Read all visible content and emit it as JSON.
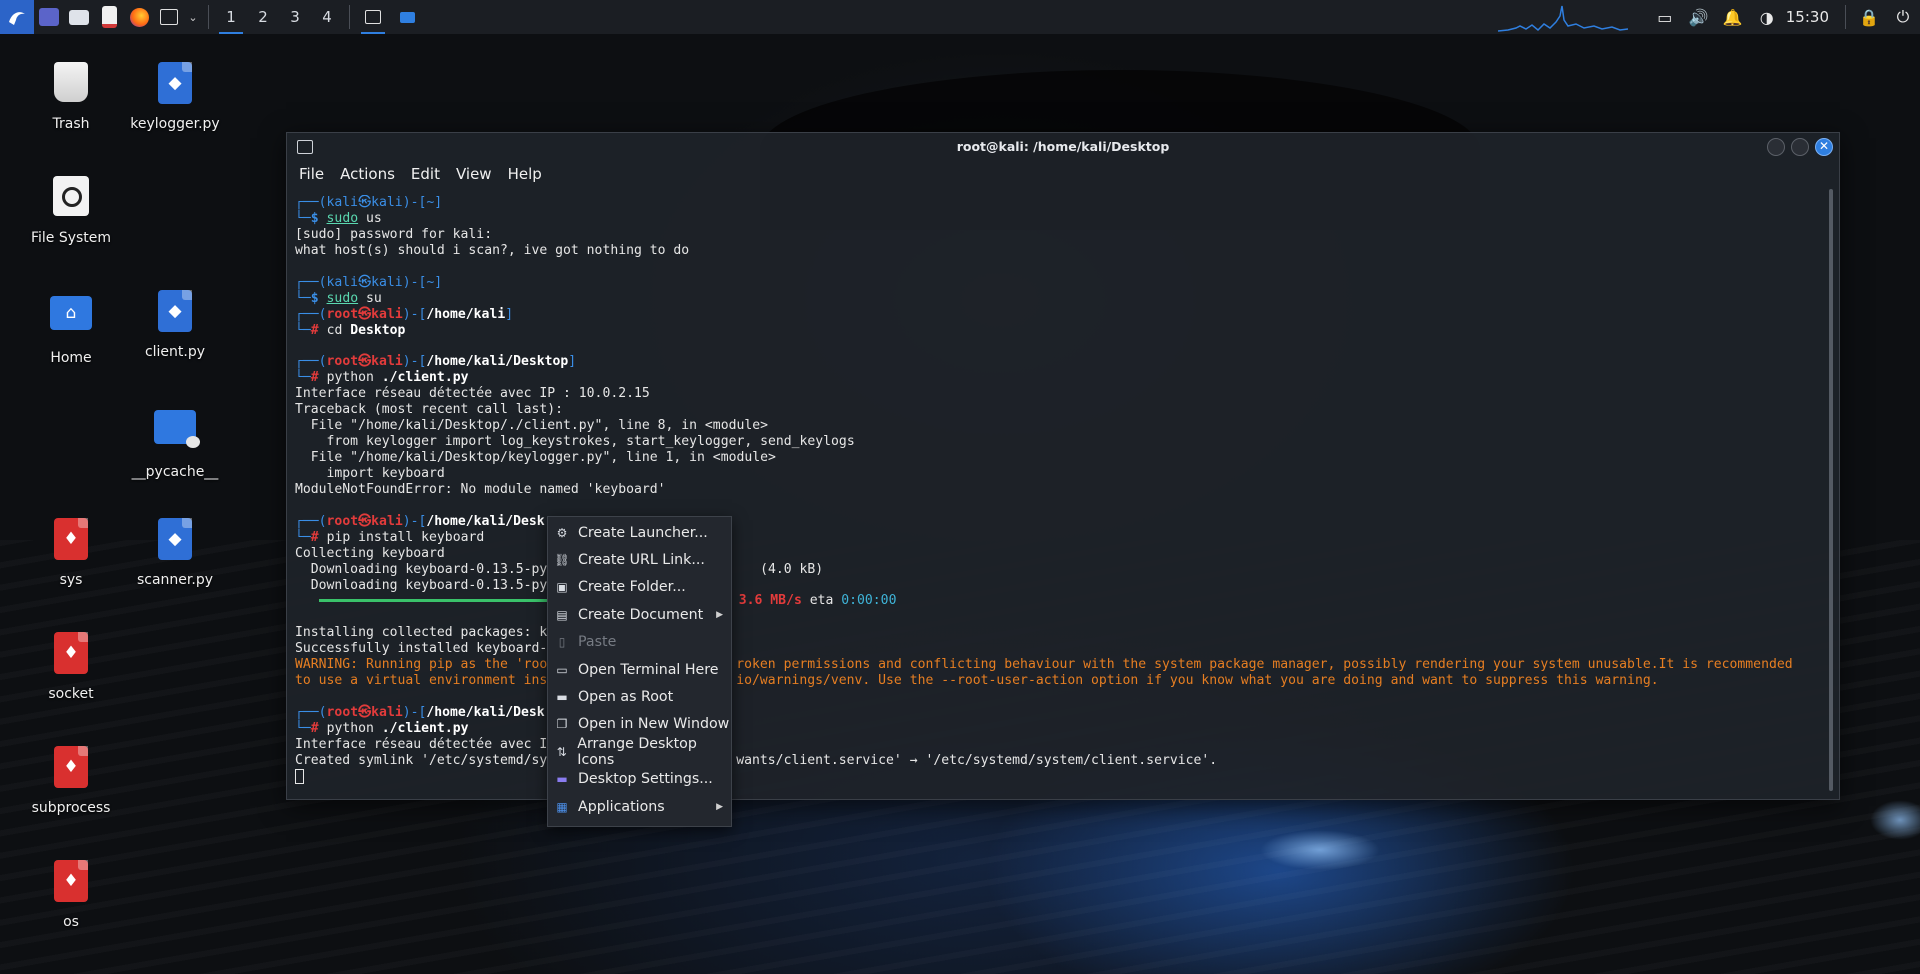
{
  "panel": {
    "workspaces": [
      "1",
      "2",
      "3",
      "4"
    ],
    "clock": "15:30"
  },
  "desktop_icons": [
    {
      "label": "Trash"
    },
    {
      "label": "keylogger.py"
    },
    {
      "label": "File System"
    },
    {
      "label": "Home"
    },
    {
      "label": "client.py"
    },
    {
      "label": "__pycache__"
    },
    {
      "label": "sys"
    },
    {
      "label": "scanner.py"
    },
    {
      "label": "socket"
    },
    {
      "label": "subprocess"
    },
    {
      "label": "os"
    }
  ],
  "terminal": {
    "title": "root@kali: /home/kali/Desktop",
    "menu": [
      "File",
      "Actions",
      "Edit",
      "View",
      "Help"
    ],
    "lines": {
      "l1": "┌──(kali㉿kali)-[~]",
      "l2a": "└─$ ",
      "l2b": "sudo",
      "l2c": " us",
      "l3": "[sudo] password for kali:",
      "l4": "what host(s) should i scan?, ive got nothing to do",
      "l6": "┌──(kali㉿kali)-[~]",
      "l7a": "└─$ ",
      "l7b": "sudo",
      "l7c": " su",
      "l8a": "┌──(",
      "l8b": "root㉿kali",
      "l8c": ")-[",
      "l8d": "/home/kali",
      "l8e": "]",
      "l9a": "└─",
      "l9b": "# ",
      "l9c": "cd ",
      "l9d": "Desktop",
      "l11a": "┌──(",
      "l11b": "root㉿kali",
      "l11c": ")-[",
      "l11d": "/home/kali/Desktop",
      "l11e": "]",
      "l12a": "└─",
      "l12b": "# ",
      "l12c": "python ",
      "l12d": "./client.py",
      "l13": "Interface réseau détectée avec IP : 10.0.2.15",
      "l14": "Traceback (most recent call last):",
      "l15": "  File \"/home/kali/Desktop/./client.py\", line 8, in <module>",
      "l16": "    from keylogger import log_keystrokes, start_keylogger, send_keylogs",
      "l17": "  File \"/home/kali/Desktop/keylogger.py\", line 1, in <module>",
      "l18": "    import keyboard",
      "l19": "ModuleNotFoundError: No module named 'keyboard'",
      "l21a": "┌──(",
      "l21b": "root㉿kali",
      "l21c": ")-[",
      "l21d": "/home/kali/Desk",
      "l22a": "└─",
      "l22b": "# ",
      "l22c": "pip install keyboard",
      "l23": "Collecting keyboard",
      "l24a": "  Downloading keyboard-0.13.5-py",
      "l24b": "                           (4.0 kB)",
      "l25a": "  Downloading keyboard-0.13.5-py3",
      "l26a": "",
      "l26b": "B 3.6 MB/s",
      "l26c": " eta ",
      "l26d": "0:00:00",
      "l27": "Installing collected packages: k",
      "l28": "Successfully installed keyboard-",
      "l29a": "WARNING: Running pip as the 'roo",
      "l29b": "roken permissions and conflicting behaviour with the system package manager, possibly rendering your system unusable.It is recommended",
      "l30a": "to use a virtual environment ins",
      "l30b": "io/warnings/venv. Use the --root-user-action option if you know what you are doing and want to suppress this warning.",
      "l32a": "┌──(",
      "l32b": "root㉿kali",
      "l32c": ")-[",
      "l32d": "/home/kali/Desk",
      "l33a": "└─",
      "l33b": "# ",
      "l33c": "python ",
      "l33d": "./client.py",
      "l34": "Interface réseau détectée avec I",
      "l35a": "Created symlink '/etc/systemd/sy",
      "l35b": "wants/client.service' → '/etc/systemd/system/client.service'."
    }
  },
  "context_menu": {
    "items": [
      {
        "label": "Create Launcher...",
        "icon": "gear-icon"
      },
      {
        "label": "Create URL Link...",
        "icon": "link-icon"
      },
      {
        "label": "Create Folder...",
        "icon": "folder-plus-icon"
      },
      {
        "label": "Create Document",
        "icon": "document-plus-icon"
      },
      {
        "label": "Paste",
        "icon": "clipboard-icon"
      },
      {
        "label": "Open Terminal Here",
        "icon": "terminal-icon"
      },
      {
        "label": "Open as Root",
        "icon": "folder-icon"
      },
      {
        "label": "Open in New Window",
        "icon": "window-icon"
      },
      {
        "label": "Arrange Desktop Icons",
        "icon": "arrange-icon"
      },
      {
        "label": "Desktop Settings...",
        "icon": "desktop-settings-icon"
      },
      {
        "label": "Applications",
        "icon": "applications-icon"
      }
    ]
  },
  "colors": {
    "accent": "#2f7fe0",
    "prompt_blue": "#3a8ee6",
    "root_red": "#e23b3b",
    "warning_orange": "#e67e22"
  }
}
